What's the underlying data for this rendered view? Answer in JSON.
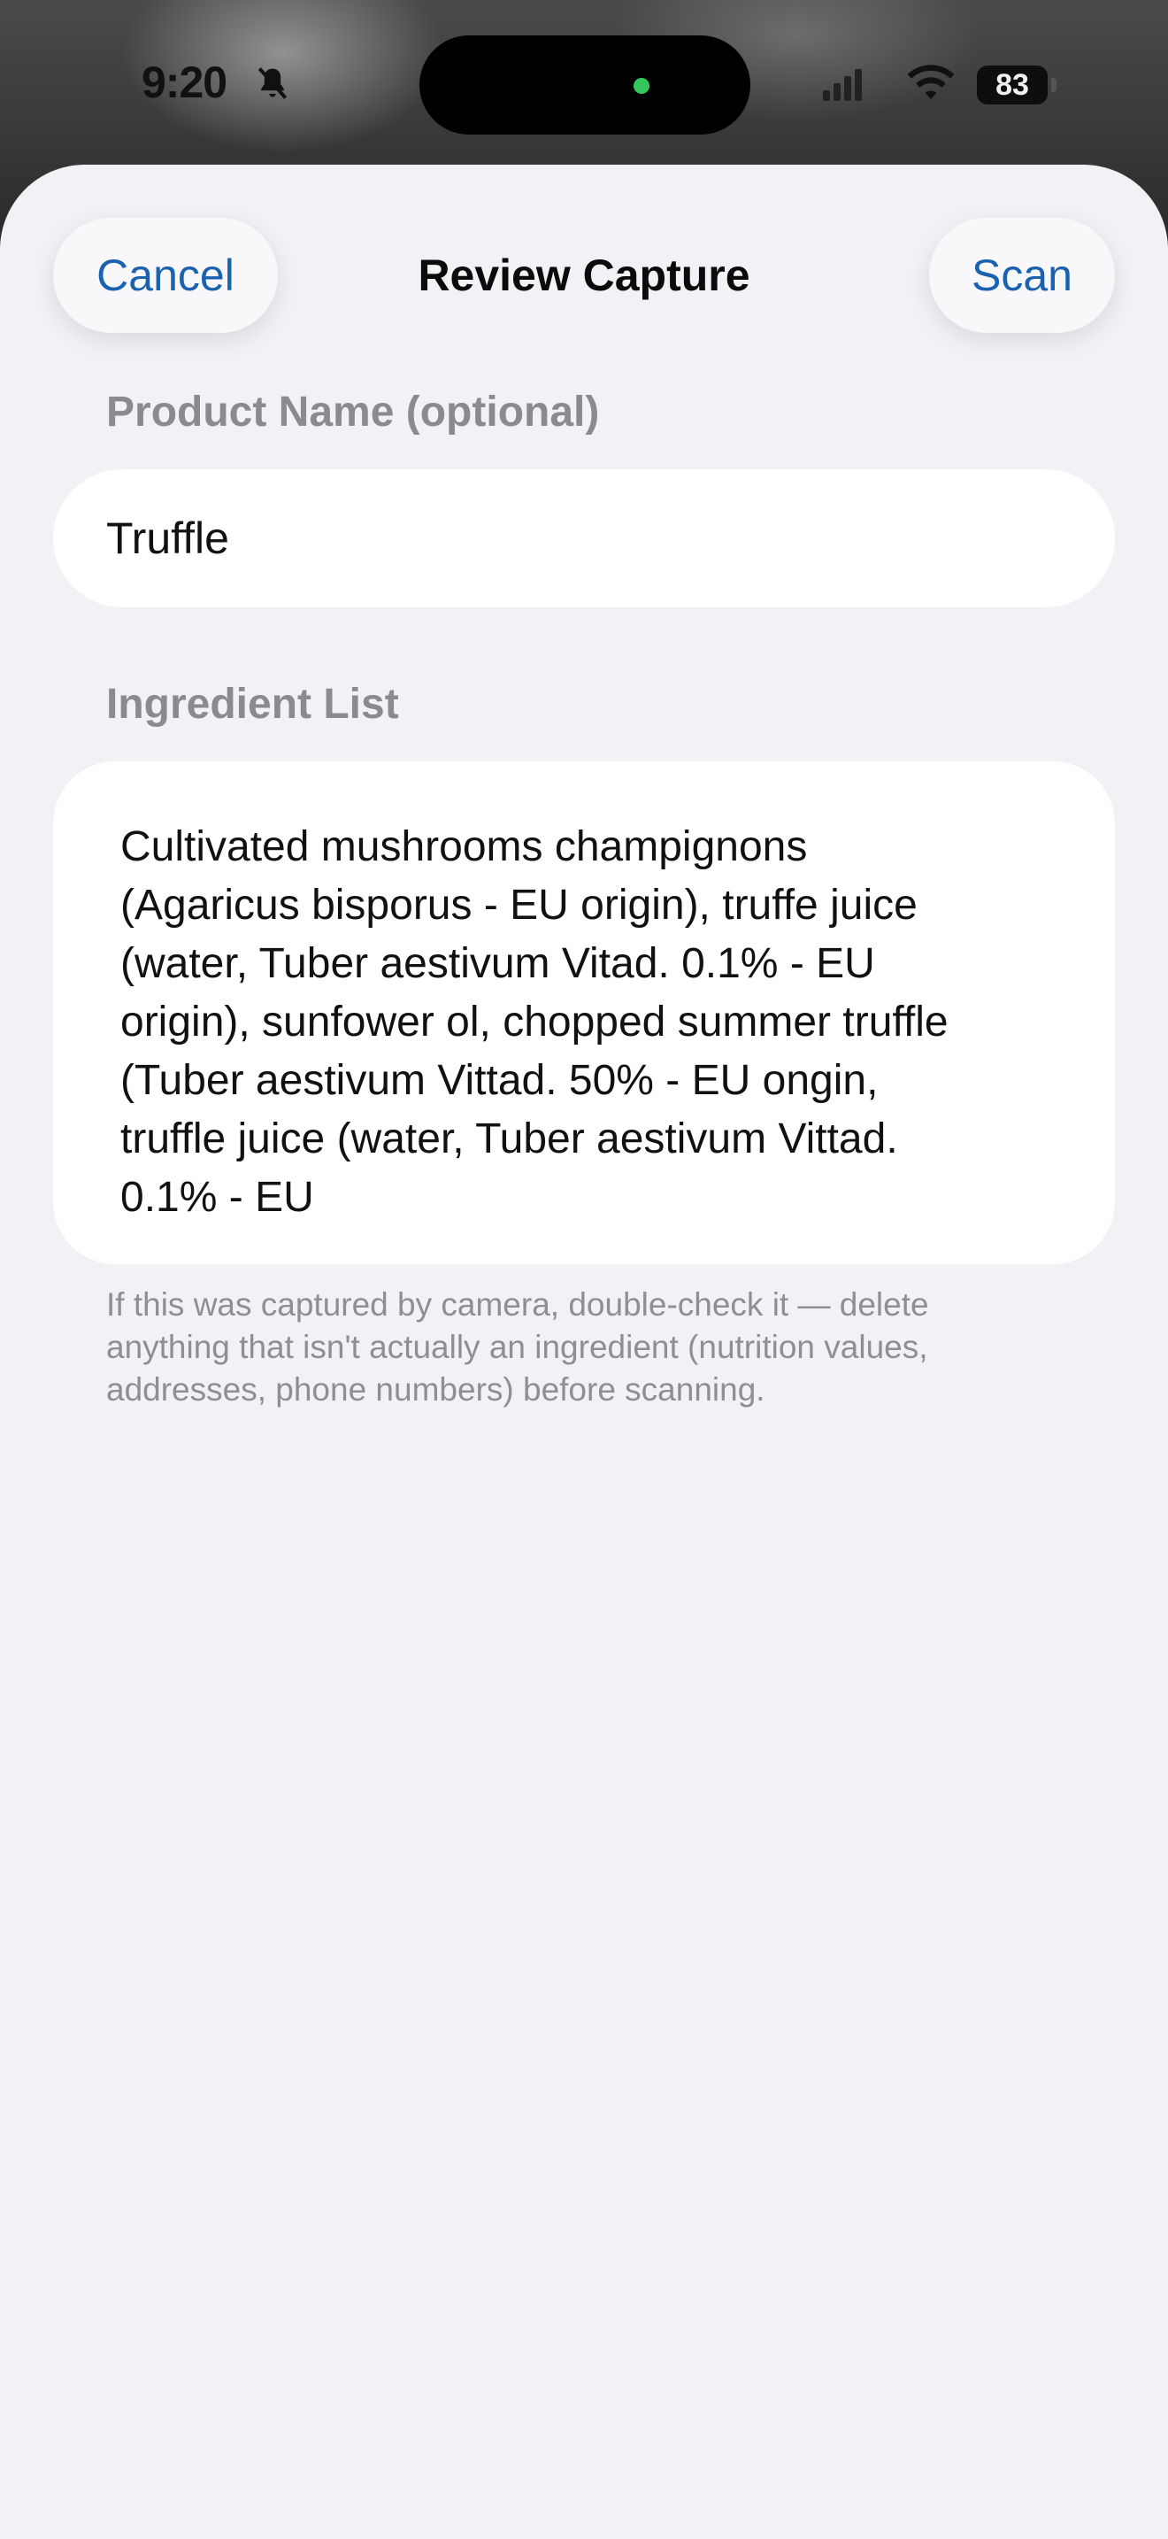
{
  "status_bar": {
    "time": "9:20",
    "battery": "83",
    "icons": [
      "bell-off-icon",
      "signal-icon",
      "wifi-icon",
      "battery-icon"
    ]
  },
  "sheet": {
    "title": "Review Capture",
    "cancel_label": "Cancel",
    "scan_label": "Scan"
  },
  "form": {
    "product_name_label": "Product Name (optional)",
    "product_name_value": "Truffle",
    "ingredient_list_label": "Ingredient List",
    "ingredient_list_value": "Cultivated mushrooms champignons\n(Agaricus bisporus - EU origin), truffe juice\n(water, Tuber aestivum Vitad. 0.1% - EU\norigin), sunfower ol, chopped summer truffle\n(Tuber aestivum Vittad. 50% - EU ongin,\ntruffle juice (water, Tuber aestivum Vittad.\n0.1% - EU",
    "hint": "If this was captured by camera, double-check it — delete\nanything that isn't actually an ingredient (nutrition values,\naddresses, phone numbers) before scanning."
  },
  "colors": {
    "accent": "#1a62b0",
    "sheet_background": "#f1f1f6",
    "field_background": "#ffffff",
    "secondary_text": "#8a8a8f",
    "camera_indicator": "#34c759"
  }
}
